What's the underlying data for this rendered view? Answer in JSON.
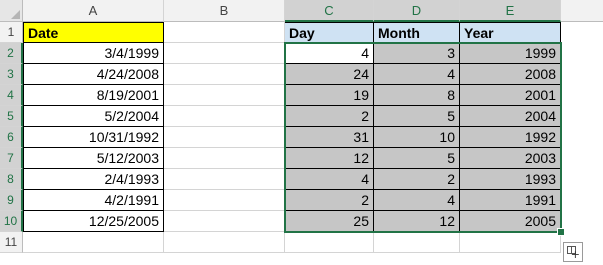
{
  "columns": [
    "A",
    "B",
    "C",
    "D",
    "E"
  ],
  "rows": [
    "1",
    "2",
    "3",
    "4",
    "5",
    "6",
    "7",
    "8",
    "9",
    "10",
    "11"
  ],
  "column_a": {
    "header": "Date",
    "values": [
      "3/4/1999",
      "4/24/2008",
      "8/19/2001",
      "5/2/2004",
      "10/31/1992",
      "5/12/2003",
      "2/4/1993",
      "4/2/1991",
      "12/25/2005"
    ]
  },
  "table": {
    "headers": [
      "Day",
      "Month",
      "Year"
    ],
    "rows": [
      [
        "4",
        "3",
        "1999"
      ],
      [
        "24",
        "4",
        "2008"
      ],
      [
        "19",
        "8",
        "2001"
      ],
      [
        "2",
        "5",
        "2004"
      ],
      [
        "31",
        "10",
        "1992"
      ],
      [
        "12",
        "5",
        "2003"
      ],
      [
        "4",
        "2",
        "1993"
      ],
      [
        "2",
        "4",
        "1991"
      ],
      [
        "25",
        "12",
        "2005"
      ]
    ]
  },
  "colors": {
    "selection_border": "#217346",
    "selection_fill": "#c6c6c6",
    "header_yellow": "#ffff00",
    "header_blue": "#cfe2f3"
  },
  "icons": {
    "corner": "select-all-icon",
    "quick_analysis": "quick-analysis-icon"
  }
}
